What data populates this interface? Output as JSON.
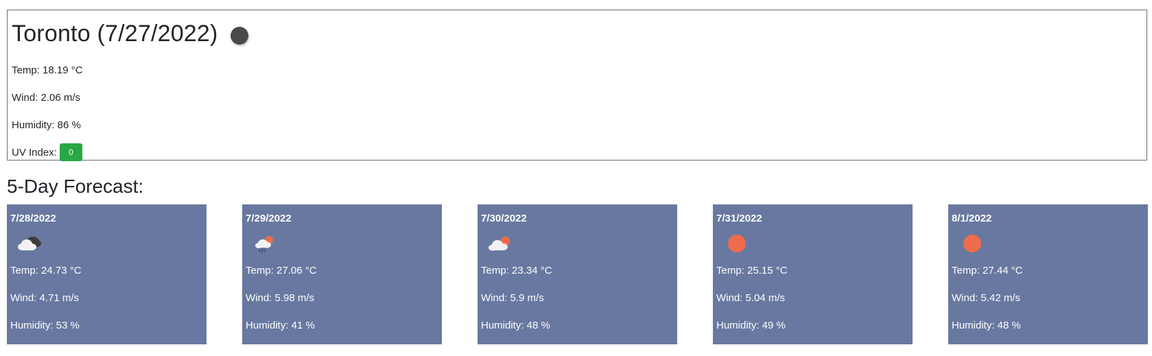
{
  "current": {
    "title": "Toronto (7/27/2022)",
    "icon": "night-clear-icon",
    "temp": "Temp: 18.19 °C",
    "wind": "Wind: 2.06 m/s",
    "humidity": "Humidity: 86 %",
    "uv_label": "UV Index:",
    "uv_value": "0",
    "uv_color": "#28a745"
  },
  "forecast": {
    "heading": "5-Day Forecast:",
    "card_color": "#6878a0",
    "days": [
      {
        "date": "7/28/2022",
        "icon": "broken-clouds-icon",
        "temp": "Temp: 24.73 °C",
        "wind": "Wind: 4.71 m/s",
        "humidity": "Humidity: 53 %"
      },
      {
        "date": "7/29/2022",
        "icon": "rain-sun-icon",
        "temp": "Temp: 27.06 °C",
        "wind": "Wind: 5.98 m/s",
        "humidity": "Humidity: 41 %"
      },
      {
        "date": "7/30/2022",
        "icon": "partly-cloudy-icon",
        "temp": "Temp: 23.34 °C",
        "wind": "Wind: 5.9 m/s",
        "humidity": "Humidity: 48 %"
      },
      {
        "date": "7/31/2022",
        "icon": "sun-icon",
        "temp": "Temp: 25.15 °C",
        "wind": "Wind: 5.04 m/s",
        "humidity": "Humidity: 49 %"
      },
      {
        "date": "8/1/2022",
        "icon": "sun-icon",
        "temp": "Temp: 27.44 °C",
        "wind": "Wind: 5.42 m/s",
        "humidity": "Humidity: 48 %"
      }
    ]
  }
}
